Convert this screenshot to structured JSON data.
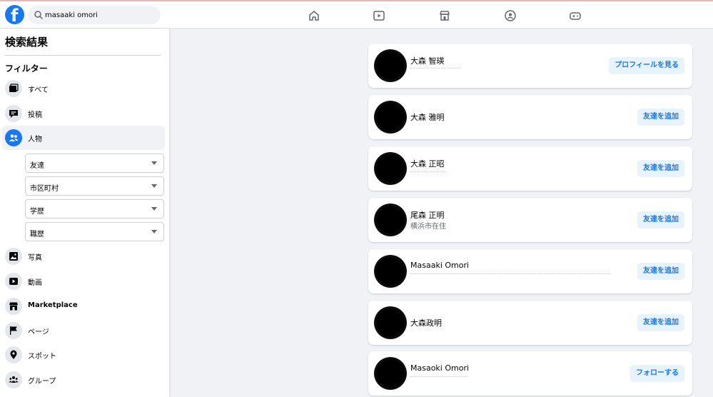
{
  "search": {
    "query": "masaaki omori"
  },
  "sidebar": {
    "title": "検索結果",
    "filter_heading": "フィルター",
    "items": [
      {
        "label": "すべて",
        "icon": "all-icon"
      },
      {
        "label": "投稿",
        "icon": "post-icon"
      },
      {
        "label": "人物",
        "icon": "people-icon",
        "active": true
      },
      {
        "label": "写真",
        "icon": "photo-icon"
      },
      {
        "label": "動画",
        "icon": "video-icon"
      },
      {
        "label": "Marketplace",
        "icon": "marketplace-icon"
      },
      {
        "label": "ページ",
        "icon": "flag-icon"
      },
      {
        "label": "スポット",
        "icon": "location-icon"
      },
      {
        "label": "グループ",
        "icon": "group-icon"
      }
    ],
    "people_filters": [
      {
        "label": "友達"
      },
      {
        "label": "市区町村"
      },
      {
        "label": "学歴"
      },
      {
        "label": "職歴"
      }
    ]
  },
  "results": [
    {
      "name": "大森 智瑛",
      "subtitle": "",
      "button": "プロフィールを見る"
    },
    {
      "name": "大森 雅明",
      "subtitle": "",
      "button": "友達を追加"
    },
    {
      "name": "大森 正昭",
      "subtitle": "",
      "button": "友達を追加"
    },
    {
      "name": "尾森 正明",
      "subtitle": "横浜市在住",
      "button": "友達を追加"
    },
    {
      "name": "Masaaki Omori",
      "subtitle": "",
      "button": "友達を追加"
    },
    {
      "name": "大森政明",
      "subtitle": "",
      "button": "友達を追加"
    },
    {
      "name": "Masaoki Omori",
      "subtitle": "",
      "button": "フォローする"
    }
  ],
  "colors": {
    "brand": "#1877f2",
    "button_bg": "#e7f3ff",
    "page_bg": "#f0f2f5"
  }
}
